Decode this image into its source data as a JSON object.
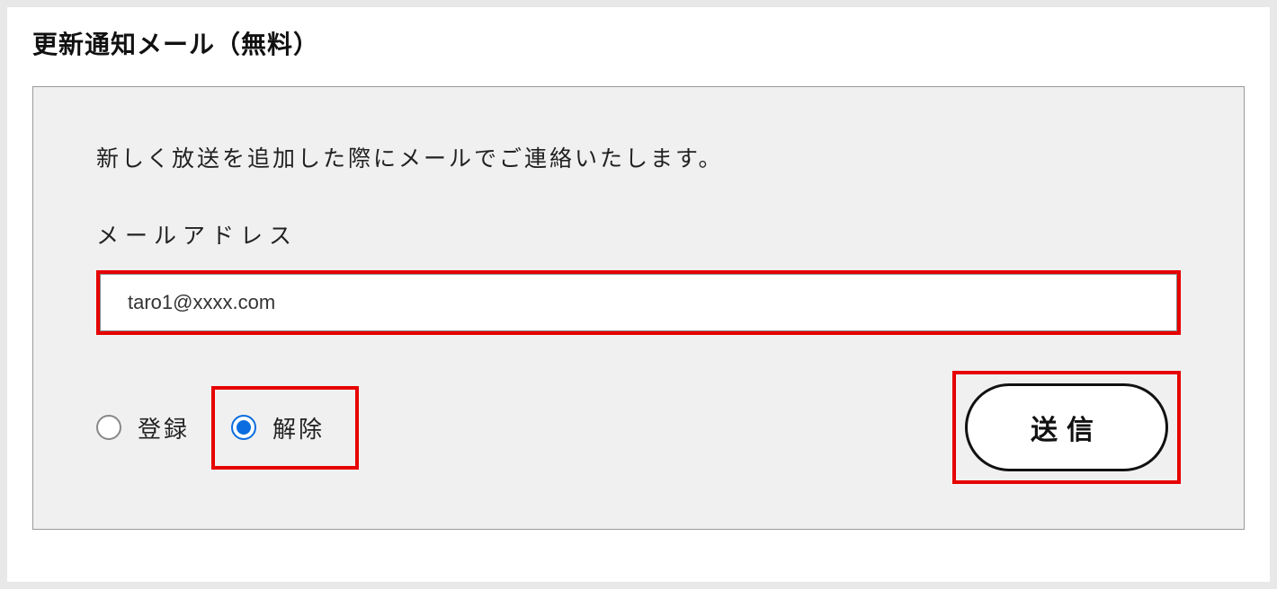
{
  "section": {
    "title": "更新通知メール（無料）"
  },
  "form": {
    "description": "新しく放送を追加した際にメールでご連絡いたします。",
    "email_label": "メールアドレス",
    "email_value": "taro1@xxxx.com",
    "radio": {
      "register_label": "登録",
      "unregister_label": "解除",
      "selected": "unregister"
    },
    "submit_label": "送信"
  },
  "highlights": {
    "color": "#e60000"
  }
}
